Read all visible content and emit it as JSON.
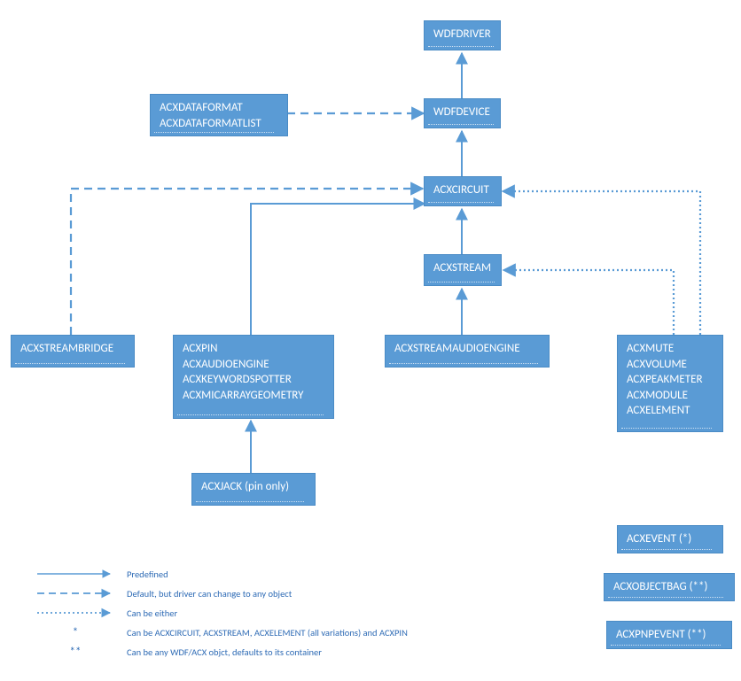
{
  "boxes": {
    "wdfdriver": "WDFDRIVER",
    "wdfdevice": "WDFDEVICE",
    "acxcircuit": "ACXCIRCUIT",
    "acxstream": "ACXSTREAM",
    "acxdataformat_line1": "ACXDATAFORMAT",
    "acxdataformat_line2": "ACXDATAFORMATLIST",
    "acxstreambridge": "ACXSTREAMBRIDGE",
    "acxpin_line1": "ACXPIN",
    "acxpin_line2": "ACXAUDIOENGINE",
    "acxpin_line3": "ACXKEYWORDSPOTTER",
    "acxpin_line4": "ACXMICARRAYGEOMETRY",
    "acxjack": "ACXJACK (pin only)",
    "acxstreamaudioengine": "ACXSTREAMAUDIOENGINE",
    "acxmute_line1": "ACXMUTE",
    "acxmute_line2": "ACXVOLUME",
    "acxmute_line3": "ACXPEAKMETER",
    "acxmute_line4": "ACXMODULE",
    "acxmute_line5": "ACXELEMENT",
    "acxevent": "ACXEVENT (*)",
    "acxobjectbag": "ACXOBJECTBAG (**)",
    "acxpnpevent": "ACXPNPEVENT (**)"
  },
  "legend": {
    "predefined": "Predefined",
    "default_change": "Default, but driver can change to any object",
    "either": "Can be either",
    "star": "Can be ACXCIRCUIT, ACXSTREAM, ACXELEMENT (all variations) and ACXPIN",
    "dstar": "Can be any WDF/ACX objct, defaults to its container"
  },
  "colors": {
    "box_fill": "#5a9bd5",
    "line": "#5a9bd5",
    "legend_text": "#2e6bb5"
  }
}
